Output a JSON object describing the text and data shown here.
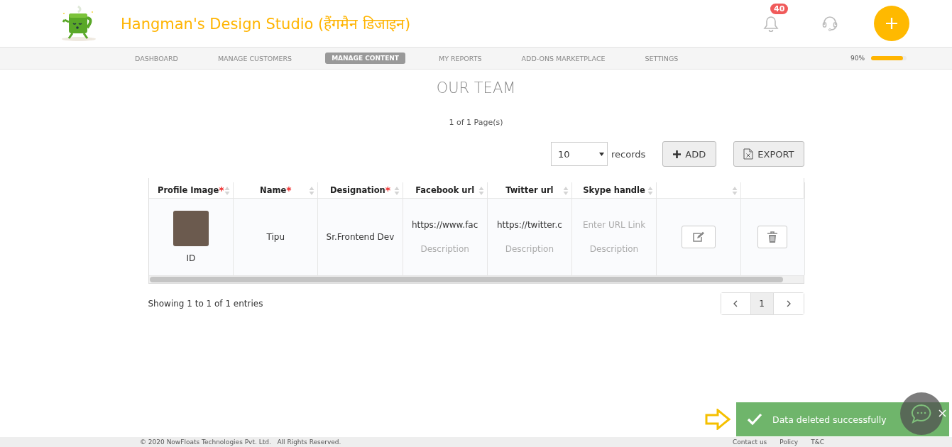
{
  "header": {
    "title": "Hangman's Design Studio (हैंगमैन डिजाइन)",
    "notification_count": "40"
  },
  "nav": {
    "items": [
      {
        "label": "DASHBOARD",
        "selected": false
      },
      {
        "label": "MANAGE CUSTOMERS",
        "selected": false
      },
      {
        "label": "MANAGE CONTENT",
        "selected": true
      },
      {
        "label": "MY REPORTS",
        "selected": false
      },
      {
        "label": "ADD-ONS MARKETPLACE",
        "selected": false
      },
      {
        "label": "SETTINGS",
        "selected": false
      }
    ],
    "progress": {
      "reading": "90%",
      "level": 0.9
    }
  },
  "page_title": "OUR TEAM",
  "page_count": "1 of 1 Page(s)",
  "toolbar": {
    "page_size": "10",
    "records_label": "records",
    "add_button": "ADD",
    "export_button": "EXPORT"
  },
  "table": {
    "columns": [
      {
        "label": "Profile Image",
        "required_mark": "*",
        "sortable": true
      },
      {
        "label": "Name",
        "required_mark": "*",
        "sortable": true
      },
      {
        "label": "Designation",
        "required_mark": "*",
        "sortable": true
      },
      {
        "label": "Facebook url",
        "sortable": true
      },
      {
        "label": "Twitter url",
        "sortable": true
      },
      {
        "label": "Skype handle",
        "sortable": true
      },
      {
        "sortable": true
      },
      {
        "sortable": false
      }
    ],
    "rows": [
      {
        "image_caption": "ID",
        "name": "Tipu",
        "designation": "Sr.Frontend Dev",
        "facebook": {
          "value": "https://www.fac",
          "description_placeholder": "Description"
        },
        "twitter": {
          "value": "https://twitter.c",
          "description_placeholder": "Description"
        },
        "skype": {
          "placeholder": "Enter URL Link",
          "description_placeholder": "Description"
        }
      }
    ]
  },
  "entries_info": "Showing 1 to 1 of 1 entries",
  "pagination": {
    "pages": [
      {
        "label": "1",
        "selected": true
      }
    ]
  },
  "toast": {
    "message": "Data deleted successfully"
  },
  "footer": {
    "copyright": "© 2020 NowFloats Technologies Pvt. Ltd.   All Rights Reserved.",
    "links": [
      "Contact us",
      "Policy",
      "T&C"
    ]
  }
}
